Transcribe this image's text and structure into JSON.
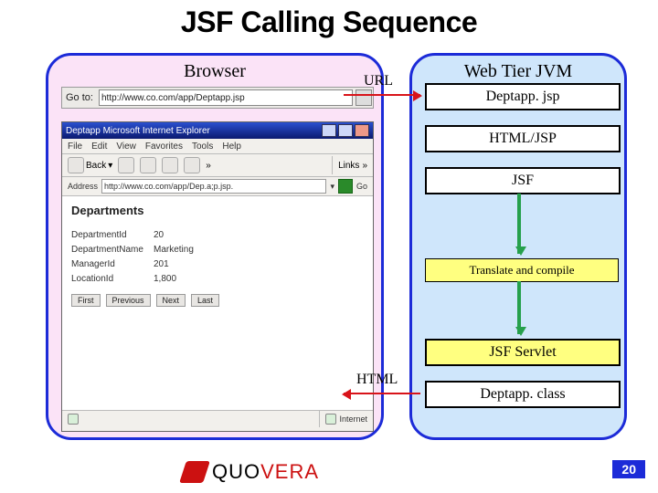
{
  "title": "JSF Calling Sequence",
  "browser": {
    "heading": "Browser",
    "goto_label": "Go to:",
    "goto_url": "http://www.co.com/app/Deptapp.jsp",
    "ie_title": "Deptapp   Microsoft Internet Explorer",
    "menu": {
      "file": "File",
      "edit": "Edit",
      "view": "View",
      "favorites": "Favorites",
      "tools": "Tools",
      "help": "Help"
    },
    "back_label": "Back",
    "links_label": "Links",
    "addr_label": "Address",
    "addr_value": "http://www.co.com/app/Dep.a;p.jsp.",
    "go_label": "Go",
    "page_heading": "Departments",
    "fields": [
      {
        "k": "DepartmentId",
        "v": "20"
      },
      {
        "k": "DepartmentName",
        "v": "Marketing"
      },
      {
        "k": "ManagerId",
        "v": "201"
      },
      {
        "k": "LocationId",
        "v": "1,800"
      }
    ],
    "nav": {
      "first": "First",
      "previous": "Previous",
      "next": "Next",
      "last": "Last"
    },
    "status_internet": "Internet"
  },
  "web": {
    "heading": "Web Tier JVM",
    "deptapp_jsp": "Deptapp. jsp",
    "html_jsp": "HTML/JSP",
    "jsf": "JSF",
    "translate": "Translate and compile",
    "jsf_servlet": "JSF Servlet",
    "deptapp_class": "Deptapp. class"
  },
  "arrows": {
    "url": "URL",
    "html": "HTML"
  },
  "footer": {
    "brand_a": "QUO",
    "brand_b": "VERA",
    "slide": "20"
  }
}
